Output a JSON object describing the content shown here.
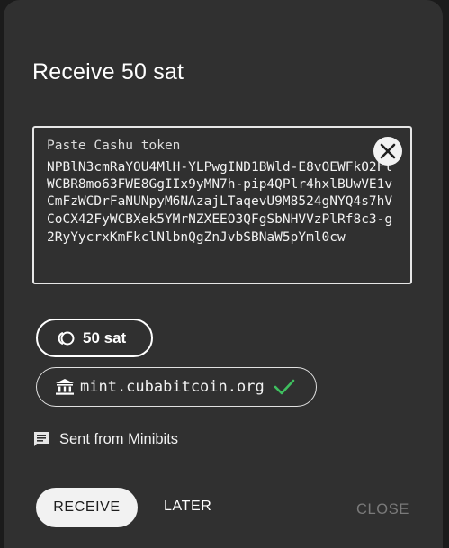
{
  "dialog": {
    "title": "Receive 50 sat"
  },
  "token_input": {
    "label": "Paste Cashu token",
    "value": "NPBlN3cmRaYOU4MlH-YLPwgIND1BWld-E8vOEWFkO2FlWCBR8mo63FWE8GgIIx9yMN7h-pip4QPlr4hxlBUwVE1vCmFzWCDrFaNUNpyM6NAzajLTaqevU9M8524gNYQ4s7hVCoCX42FyWCBXek5YMrNZXEEO3QFgSbNHVVzPlRf8c3-g2RyYycrxKmFkclNlbnQgZnJvbSBNaW5pYml0cw"
  },
  "amount": {
    "label": "50 sat"
  },
  "mint": {
    "url": "mint.cubabitcoin.org",
    "verified_color": "#3fbf5f"
  },
  "memo": {
    "text": "Sent from Minibits"
  },
  "actions": {
    "receive": "RECEIVE",
    "later": "LATER",
    "close": "CLOSE"
  }
}
